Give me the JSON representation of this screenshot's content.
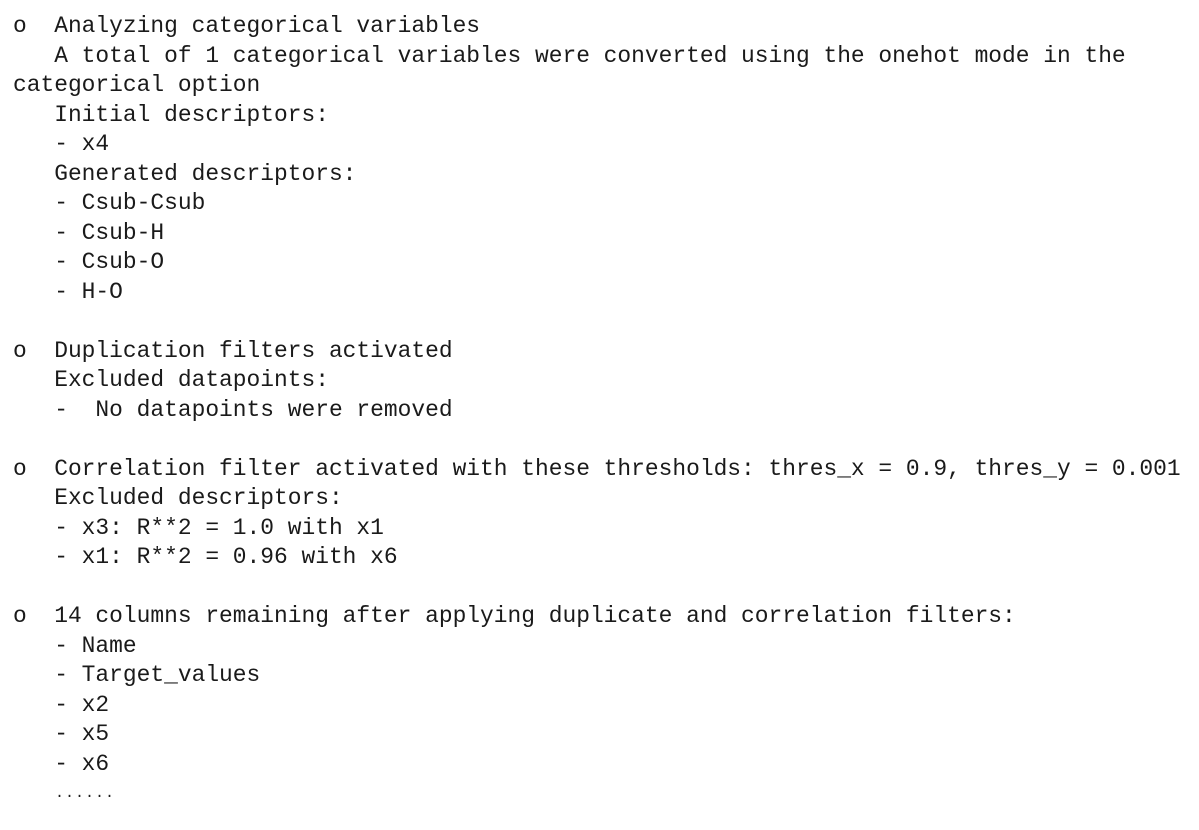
{
  "lines": [
    "o  Analyzing categorical variables",
    "   A total of 1 categorical variables were converted using the onehot mode in the",
    "categorical option",
    "   Initial descriptors:",
    "   - x4",
    "   Generated descriptors:",
    "   - Csub-Csub",
    "   - Csub-H",
    "   - Csub-O",
    "   - H-O",
    "",
    "o  Duplication filters activated",
    "   Excluded datapoints:",
    "   -  No datapoints were removed",
    "",
    "o  Correlation filter activated with these thresholds: thres_x = 0.9, thres_y = 0.001",
    "   Excluded descriptors:",
    "   - x3: R**2 = 1.0 with x1",
    "   - x1: R**2 = 0.96 with x6",
    "",
    "o  14 columns remaining after applying duplicate and correlation filters:",
    "   - Name",
    "   - Target_values",
    "   - x2",
    "   - x5",
    "   - x6"
  ],
  "ellipsis": "......"
}
